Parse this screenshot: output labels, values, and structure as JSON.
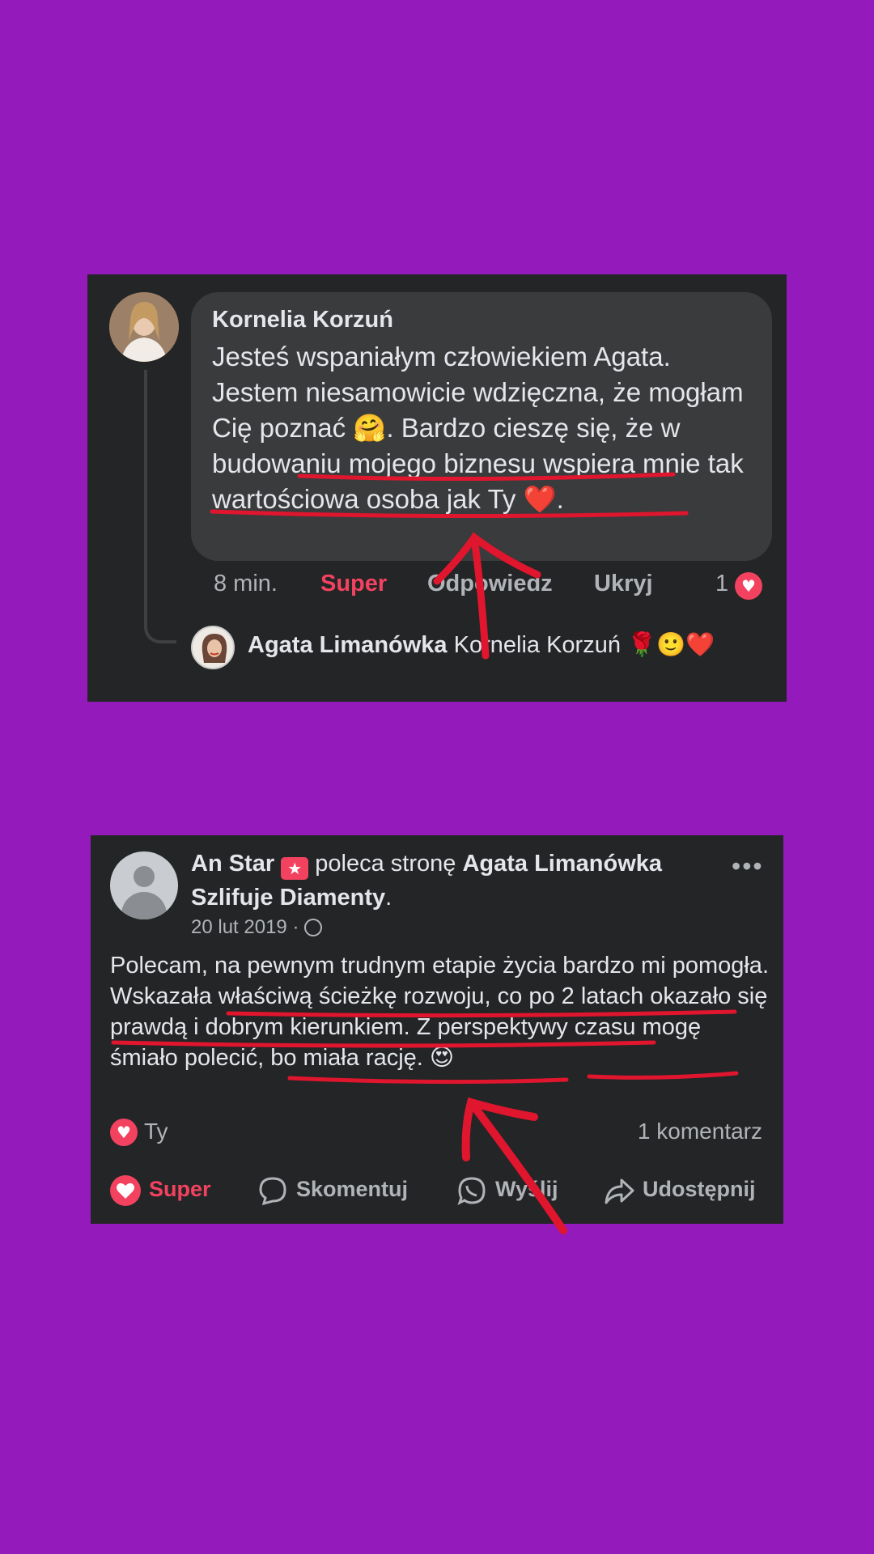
{
  "comment": {
    "author": "Kornelia Korzuń",
    "text": "Jesteś wspaniałym człowiekiem Agata. Jestem niesamowicie wdzięczna, że mogłam Cię poznać 🤗. Bardzo cieszę się, że w budowaniu mojego biznesu wspiera mnie tak wartościowa osoba jak Ty ❤️.",
    "time": "8 min.",
    "like_label": "Super",
    "reply_label": "Odpowiedz",
    "hide_label": "Ukryj",
    "reaction_count": "1",
    "reaction_icon": "heart-icon",
    "reply": {
      "author": "Agata Limanówka",
      "mention": "Kornelia Korzuń",
      "emojis": "🌹🙂❤️"
    }
  },
  "post": {
    "author": "An Star",
    "action": "poleca stronę",
    "page_name": "Agata Limanówka Szlifuje Diamenty",
    "date": "20 lut 2019 ·",
    "privacy_icon": "globe-icon",
    "text": "Polecam, na pewnym trudnym etapie życia bardzo mi pomogła. Wskazała właściwą ścieżkę rozwoju, co po 2 latach okazało się prawdą i dobrym kierunkiem. Z perspektywy czasu mogę śmiało polecić, bo miała rację. 😍",
    "reaction_label": "Ty",
    "comments_count": "1 komentarz",
    "actions": {
      "super": "Super",
      "comment": "Skomentuj",
      "send": "Wyślij",
      "share": "Udostępnij"
    }
  },
  "colors": {
    "background": "#951ABB",
    "card": "#242526",
    "bubble": "#3A3B3C",
    "accent": "#F3425F",
    "annotation": "#E0152E"
  }
}
